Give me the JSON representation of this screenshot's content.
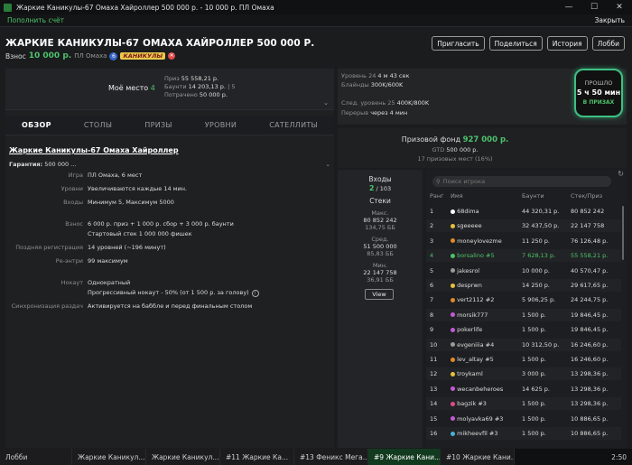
{
  "window": {
    "title": "Жаркие Каникулы-67 Омаха Хайроллер 500 000 р. - 10 000 р. ПЛ Омаха",
    "minimize": "—",
    "maximize": "☐",
    "close": "✕"
  },
  "menubar": {
    "topup": "Пополнить счёт",
    "close_label": "Закрыть"
  },
  "header": {
    "title": "ЖАРКИЕ КАНИКУЛЫ-67 ОМАХА ХАЙРОЛЛЕР 500 000 Р.",
    "buyin_label": "Взнос",
    "buyin_amount": "10 000 р.",
    "game": "ПЛ Омаха",
    "badge_six": "6",
    "badge_tag": "КАНИКУЛЫ",
    "badge_x": "✕",
    "buttons": [
      "Пригласить",
      "Поделиться",
      "История",
      "Лобби"
    ]
  },
  "myplace": {
    "label": "Моё место",
    "num": "4",
    "prize_label": "Приз",
    "prize": "55 558,21 р.",
    "bounty_label": "Баунти",
    "bounty": "14 203,13 р.",
    "bounty_sep": "|",
    "bounty_count": "5",
    "spent_label": "Потрачено",
    "spent": "50 000 р."
  },
  "tabs": [
    "ОБЗОР",
    "СТОЛЫ",
    "ПРИЗЫ",
    "УРОВНИ",
    "САТЕЛЛИТЫ"
  ],
  "overview": {
    "title": "Жаркие Каникулы-67 Омаха Хайроллер",
    "guarantee": "Гарантия:",
    "guarantee_val": "500 000 ...",
    "rows": [
      {
        "label": "Игра",
        "value": "ПЛ Омаха, 6 мест"
      },
      {
        "label": "Уровни",
        "value": "Увеличиваются каждые 14 мин."
      },
      {
        "label": "Входы",
        "value": "Минимум 5, Максимум 5000"
      },
      {
        "label": "Взнос",
        "value": "6 000 р. приз + 1 000 р. сбор + 3 000 р. баунти"
      },
      {
        "label": "",
        "value": "Стартовый стек 1 000 000 фишек"
      },
      {
        "label": "Поздняя регистрация",
        "value": "14 уровней (~196 минут)"
      },
      {
        "label": "Ре-энтри",
        "value": "99 максимум"
      },
      {
        "label": "Нокаут",
        "value": "Однократный"
      },
      {
        "label": "",
        "value": "Прогрессивный нокаут - 50% (от 1 500 р. за голову)"
      },
      {
        "label": "Синхронизация раздач",
        "value": "Активируется на баббле и перед финальным столом"
      }
    ]
  },
  "level": {
    "level_label": "Уровень",
    "level_num": "24",
    "level_time": "4 м 43 сек",
    "blinds_label": "Блайнды",
    "blinds": "300K/600K",
    "next_label": "След. уровень",
    "next_num": "25",
    "next_blinds": "400K/800K",
    "break_label": "Перерыв",
    "break": "через 4 мин"
  },
  "timer": {
    "passed": "ПРОШЛО",
    "time": "5 ч 50 мин",
    "status": "В ПРИЗАХ"
  },
  "prizefund": {
    "label": "Призовой фонд",
    "amount": "927 000 р.",
    "gtd_label": "GTD",
    "gtd": "500 000 р.",
    "places": "17 призовых мест (16%)"
  },
  "entries": {
    "label": "Входы",
    "current": "2",
    "total": "/ 103",
    "stacks_label": "Стеки",
    "max_label": "Макс.",
    "max": "80 852 242",
    "max_bb": "134,75 ББ",
    "avg_label": "Сред.",
    "avg": "51 500 000",
    "avg_bb": "85,83 ББ",
    "min_label": "Мин.",
    "min": "22 147 758",
    "min_bb": "36,91 ББ",
    "view": "View"
  },
  "players": {
    "search_placeholder": "Поиск игрока",
    "headers": [
      "Ранг",
      "Имя",
      "Баунти",
      "Стек/Приз"
    ],
    "rows": [
      {
        "rank": "1",
        "name": "68dima",
        "bounty": "44 320,31 р.",
        "stack": "80 852 242",
        "color": "#ffffff"
      },
      {
        "rank": "2",
        "name": "sgeeeee",
        "bounty": "32 437,50 р.",
        "stack": "22 147 758",
        "color": "#e6c23a"
      },
      {
        "rank": "3",
        "name": "moneylovezme",
        "bounty": "11 250 р.",
        "stack": "76 126,48 р.",
        "color": "#e08a2a"
      },
      {
        "rank": "4",
        "name": "borsalino #5",
        "bounty": "7 628,13 р.",
        "stack": "55 558,21 р.",
        "color": "#4cc36b"
      },
      {
        "rank": "5",
        "name": "jakesrol",
        "bounty": "10 000 р.",
        "stack": "40 570,47 р.",
        "color": "#9a9a9a"
      },
      {
        "rank": "6",
        "name": "desprwn",
        "bounty": "14 250 р.",
        "stack": "29 617,65 р.",
        "color": "#e6c23a"
      },
      {
        "rank": "7",
        "name": "vert2112 #2",
        "bounty": "5 906,25 р.",
        "stack": "24 244,75 р.",
        "color": "#e08a2a"
      },
      {
        "rank": "8",
        "name": "morsik777",
        "bounty": "1 500 р.",
        "stack": "19 846,45 р.",
        "color": "#c25bd6"
      },
      {
        "rank": "9",
        "name": "pokerlife",
        "bounty": "1 500 р.",
        "stack": "19 846,45 р.",
        "color": "#c25bd6"
      },
      {
        "rank": "10",
        "name": "evgeniiia #4",
        "bounty": "10 312,50 р.",
        "stack": "16 246,60 р.",
        "color": "#9a9a9a"
      },
      {
        "rank": "11",
        "name": "lev_altay #5",
        "bounty": "1 500 р.",
        "stack": "16 246,60 р.",
        "color": "#e08a2a"
      },
      {
        "rank": "12",
        "name": "troykaml",
        "bounty": "3 000 р.",
        "stack": "13 298,36 р.",
        "color": "#e6c23a"
      },
      {
        "rank": "13",
        "name": "wecanbeheroes",
        "bounty": "14 625 р.",
        "stack": "13 298,36 р.",
        "color": "#c25bd6"
      },
      {
        "rank": "14",
        "name": "bagzik #3",
        "bounty": "1 500 р.",
        "stack": "13 298,36 р.",
        "color": "#e14a8a"
      },
      {
        "rank": "15",
        "name": "molyavka69 #3",
        "bounty": "1 500 р.",
        "stack": "10 886,65 р.",
        "color": "#c25bd6"
      },
      {
        "rank": "16",
        "name": "mikheevfil #3",
        "bounty": "1 500 р.",
        "stack": "10 886,65 р.",
        "color": "#4ab0d6"
      }
    ]
  },
  "taskbar": {
    "tasks": [
      "Лобби",
      "Жаркие Каникул...",
      "Жаркие Каникул...",
      "#11 Жаркие Ка...",
      "#13 Феникс Мега...",
      "#9 Жаркие Кани...",
      "#10 Жаркие Кани..."
    ],
    "clock": "2:50"
  }
}
